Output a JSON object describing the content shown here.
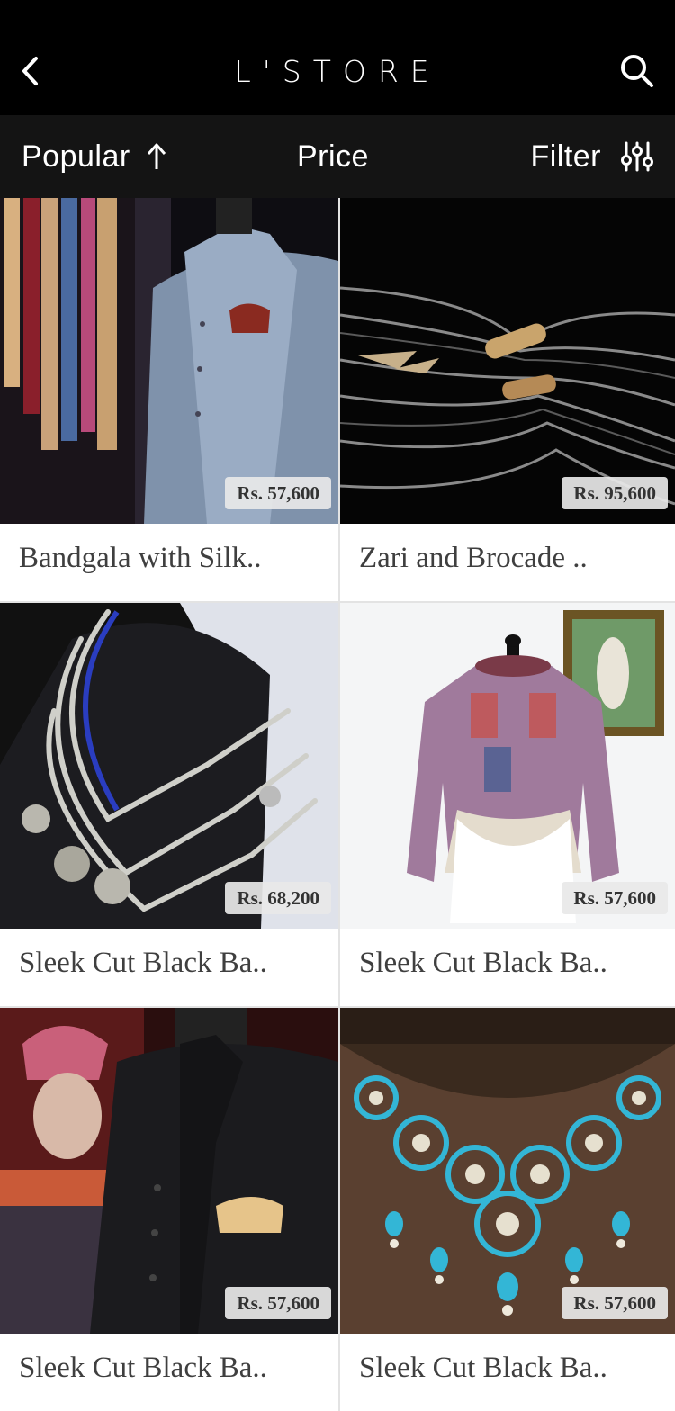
{
  "header": {
    "logo": "L'STORE",
    "back_icon": "chevron-left-icon",
    "search_icon": "search-icon"
  },
  "sortbar": {
    "popular_label": "Popular",
    "price_label": "Price",
    "filter_label": "Filter"
  },
  "products": [
    {
      "title": "Bandgala with Silk..",
      "price": "Rs. 57,600"
    },
    {
      "title": "Zari and Brocade ..",
      "price": "Rs. 95,600"
    },
    {
      "title": "Sleek Cut Black Ba..",
      "price": "Rs. 68,200"
    },
    {
      "title": "Sleek Cut Black Ba..",
      "price": "Rs. 57,600"
    },
    {
      "title": "Sleek Cut Black Ba..",
      "price": "Rs. 57,600"
    },
    {
      "title": "Sleek Cut Black Ba..",
      "price": "Rs. 57,600"
    }
  ],
  "colors": {
    "header_bg": "#000000",
    "sortbar_bg": "#141414",
    "text_dark": "#3f3f3f"
  }
}
